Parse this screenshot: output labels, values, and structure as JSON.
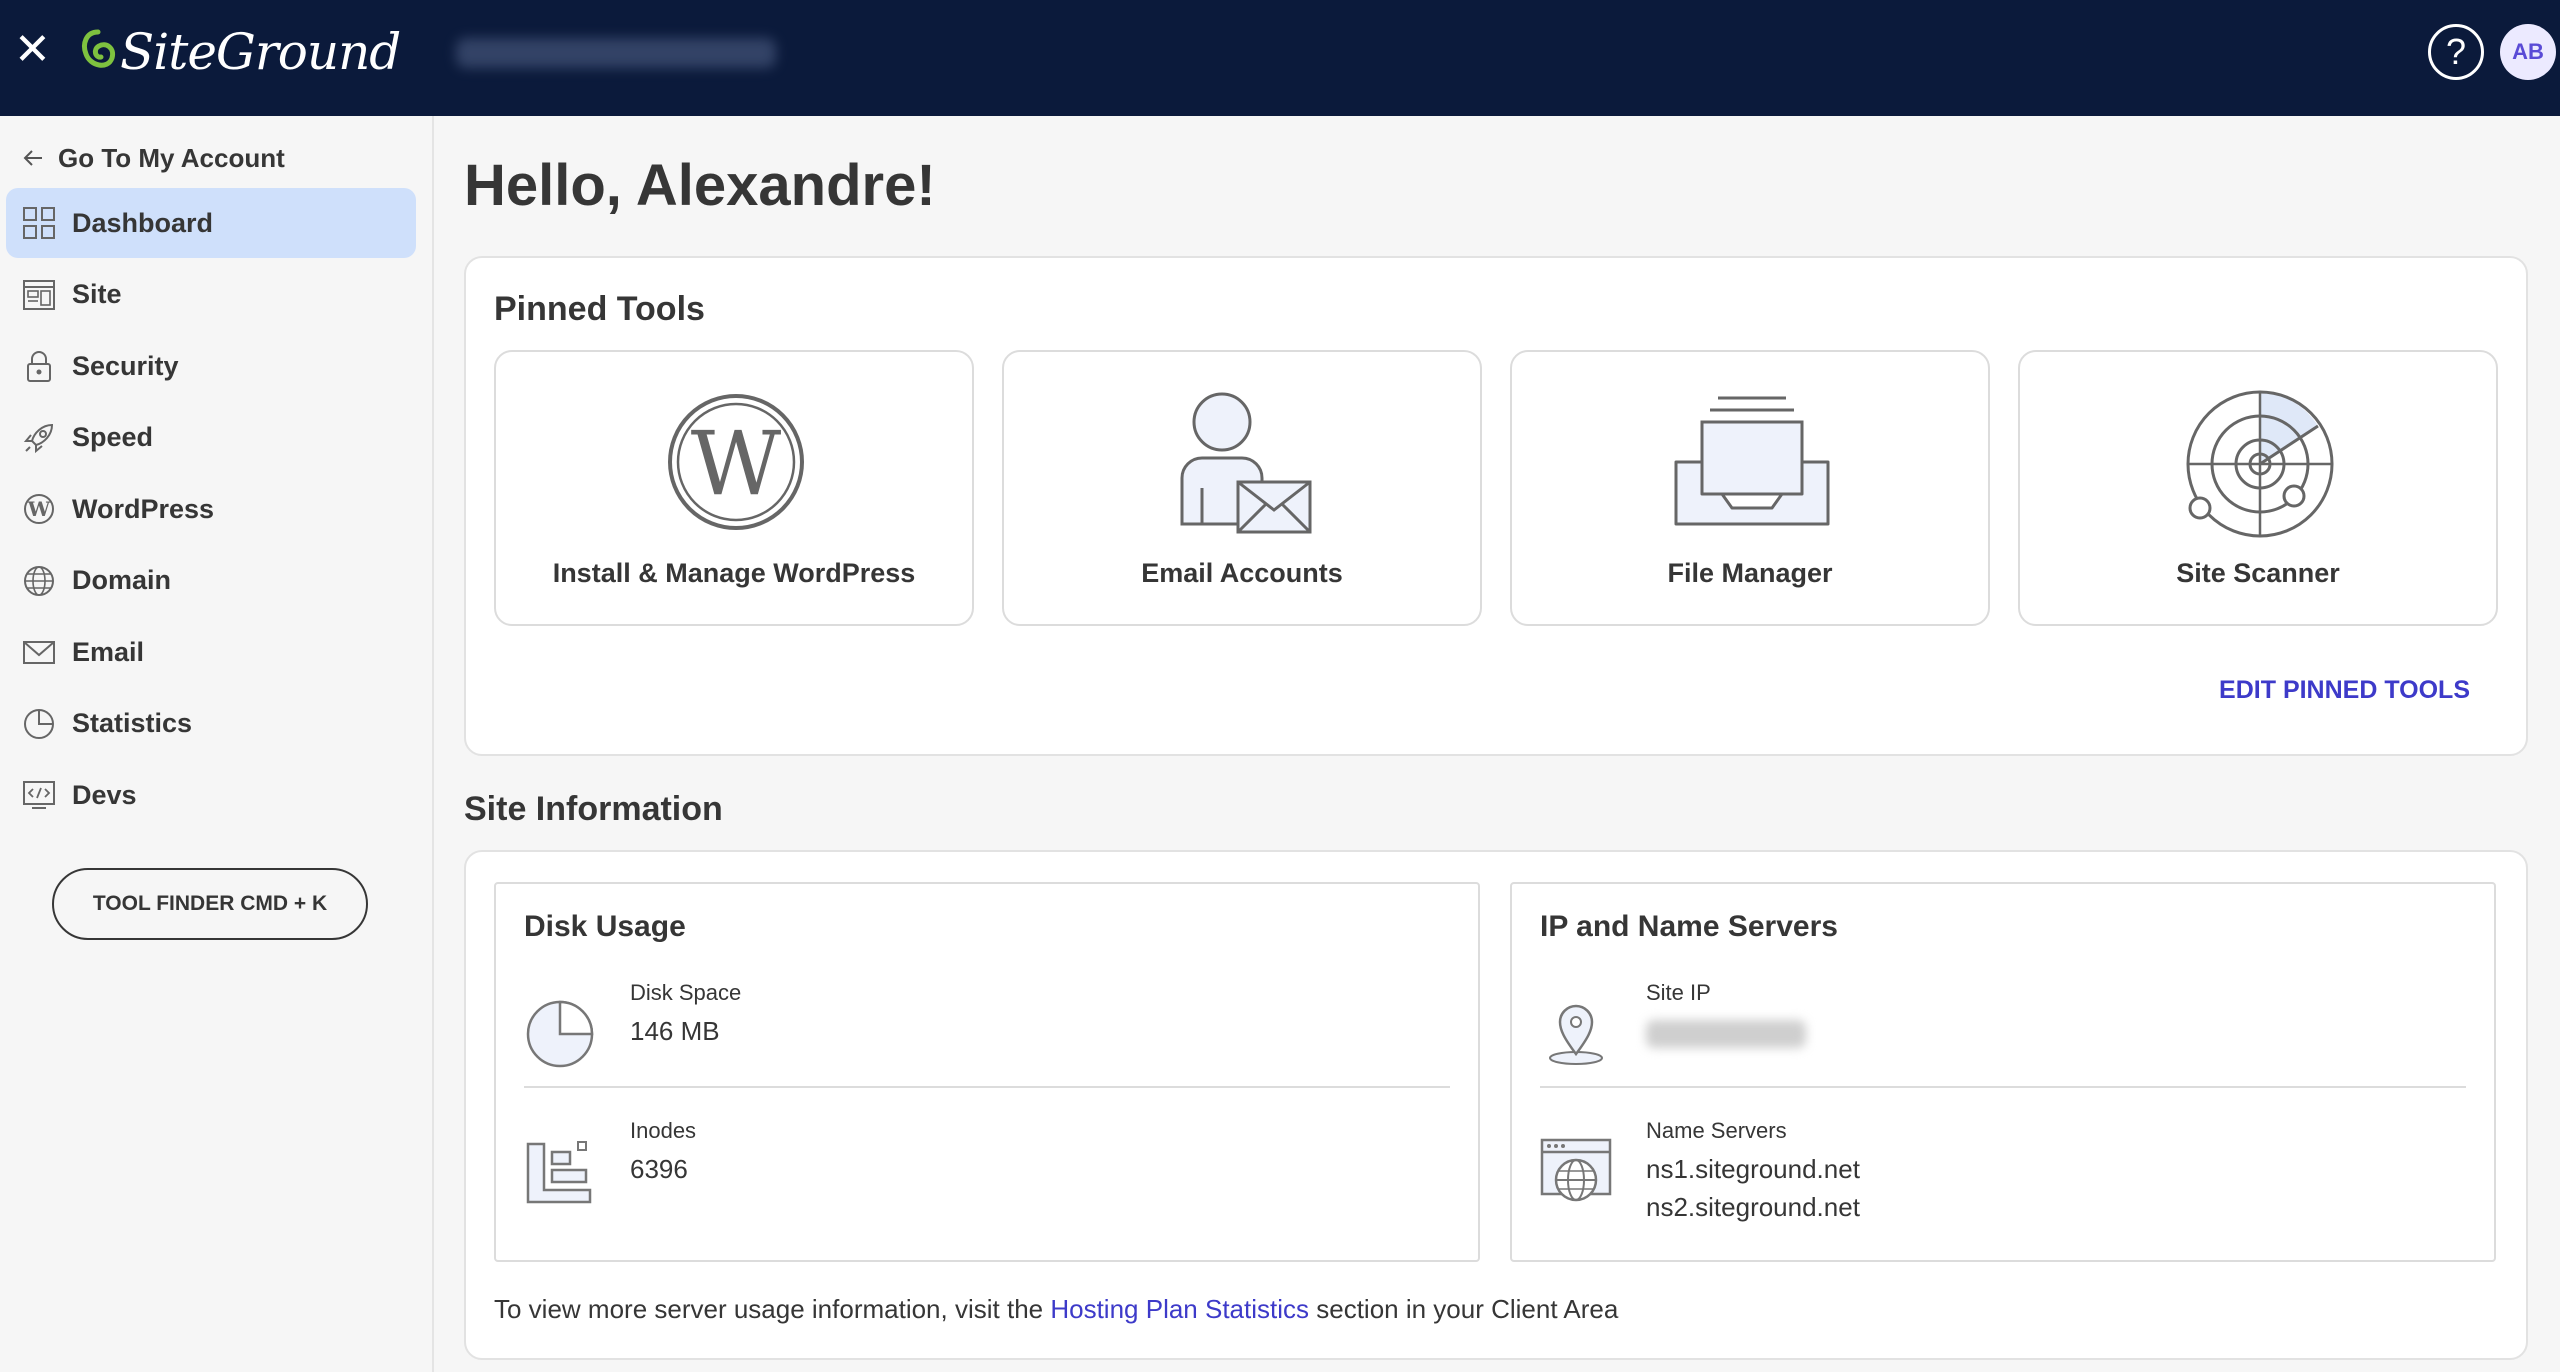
{
  "topbar": {
    "close_icon": "close-icon",
    "brand": "SiteGround",
    "help_label": "?",
    "avatar_initials": "AB"
  },
  "sidebar": {
    "back_label": "Go To My Account",
    "items": [
      {
        "label": "Dashboard",
        "icon": "grid-icon",
        "active": true
      },
      {
        "label": "Site",
        "icon": "site-icon",
        "active": false
      },
      {
        "label": "Security",
        "icon": "lock-icon",
        "active": false
      },
      {
        "label": "Speed",
        "icon": "rocket-icon",
        "active": false
      },
      {
        "label": "WordPress",
        "icon": "wordpress-icon",
        "active": false
      },
      {
        "label": "Domain",
        "icon": "globe-icon",
        "active": false
      },
      {
        "label": "Email",
        "icon": "envelope-icon",
        "active": false
      },
      {
        "label": "Statistics",
        "icon": "pie-chart-icon",
        "active": false
      },
      {
        "label": "Devs",
        "icon": "code-icon",
        "active": false
      }
    ],
    "tool_finder_label": "TOOL FINDER CMD + K"
  },
  "main": {
    "greeting": "Hello, Alexandre!",
    "pinned_tools": {
      "title": "Pinned Tools",
      "tools": [
        {
          "label": "Install & Manage WordPress",
          "icon": "wordpress-icon"
        },
        {
          "label": "Email Accounts",
          "icon": "email-accounts-icon"
        },
        {
          "label": "File Manager",
          "icon": "file-manager-icon"
        },
        {
          "label": "Site Scanner",
          "icon": "site-scanner-icon"
        }
      ],
      "edit_label": "EDIT PINNED TOOLS"
    },
    "site_information": {
      "title": "Site Information",
      "disk_usage": {
        "title": "Disk Usage",
        "disk_space_label": "Disk Space",
        "disk_space_value": "146 MB",
        "inodes_label": "Inodes",
        "inodes_value": "6396"
      },
      "servers": {
        "title": "IP and Name Servers",
        "site_ip_label": "Site IP",
        "name_servers_label": "Name Servers",
        "ns1": "ns1.siteground.net",
        "ns2": "ns2.siteground.net"
      },
      "footnote_before": "To view more server usage information, visit the ",
      "footnote_link": "Hosting Plan Statistics",
      "footnote_after": " section in your Client Area"
    }
  },
  "colors": {
    "topbar_bg": "#0b1a3b",
    "accent": "#3d3ac9",
    "active_nav_bg": "#cfe0fb",
    "logo_green": "#7ec23f"
  }
}
